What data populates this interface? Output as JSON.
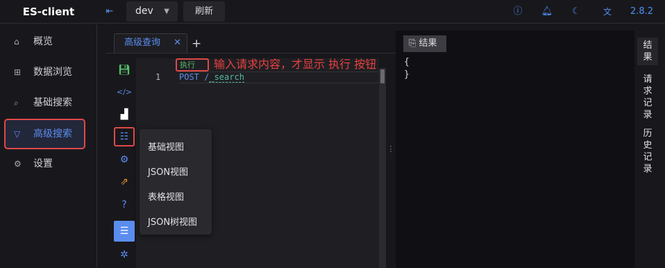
{
  "app": {
    "title": "ES-client",
    "version": "2.8.2"
  },
  "header": {
    "env_value": "dev",
    "refresh_label": "刷新"
  },
  "sidebar": {
    "items": [
      {
        "label": "概览",
        "icon": "home-icon"
      },
      {
        "label": "数据浏览",
        "icon": "grid-icon"
      },
      {
        "label": "基础搜索",
        "icon": "search-icon"
      },
      {
        "label": "高级搜索",
        "icon": "filter-icon",
        "active": true
      },
      {
        "label": "设置",
        "icon": "gear-icon"
      }
    ]
  },
  "editor": {
    "tab_label": "高级查询",
    "run_label": "执行",
    "line_number": "1",
    "method": "POST",
    "path_sep": " /",
    "path": "_search",
    "annotation": "输入请求内容，才显示 执行 按钮"
  },
  "view_menu": {
    "items": [
      "基础视图",
      "JSON视图",
      "表格视图",
      "JSON树视图"
    ]
  },
  "result": {
    "button_label": "结果",
    "json_open": "{",
    "json_close": "}"
  },
  "right_tabs": {
    "result": "结果",
    "history": "请求记录",
    "records": "历史记录"
  },
  "colors": {
    "accent": "#5b8def",
    "highlight": "#e04848",
    "annotation": "#e84040",
    "bg": "#18181c"
  }
}
